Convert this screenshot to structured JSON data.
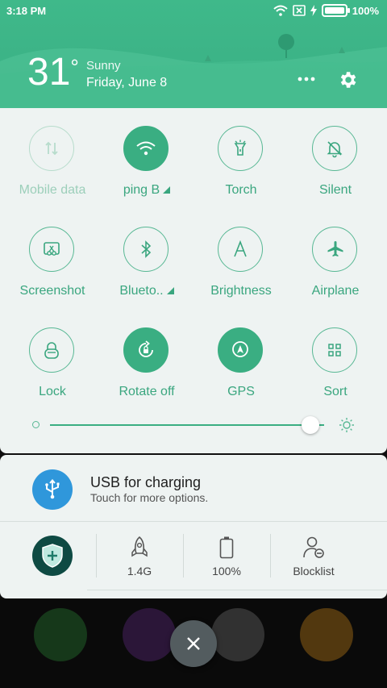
{
  "status": {
    "time": "3:18 PM",
    "battery_level": "100%",
    "battery_fill": 1.0
  },
  "weather": {
    "temperature": "31",
    "degree": "°",
    "condition": "Sunny",
    "date": "Friday, June 8"
  },
  "header_actions": {
    "more_icon": "more-dots-icon",
    "settings_icon": "gear-icon"
  },
  "toggles": [
    {
      "label": "Mobile data",
      "icon": "mobile-data-icon",
      "state": "disabled"
    },
    {
      "label": "ping B",
      "icon": "wifi-icon",
      "state": "on",
      "expandable": true
    },
    {
      "label": "Torch",
      "icon": "torch-icon",
      "state": "off"
    },
    {
      "label": "Silent",
      "icon": "bell-off-icon",
      "state": "off"
    },
    {
      "label": "Screenshot",
      "icon": "scissors-icon",
      "state": "off"
    },
    {
      "label": "Blueto..",
      "icon": "bluetooth-icon",
      "state": "off",
      "expandable": true
    },
    {
      "label": "Brightness",
      "icon": "brightness-a-icon",
      "state": "off"
    },
    {
      "label": "Airplane",
      "icon": "airplane-icon",
      "state": "off"
    },
    {
      "label": "Lock",
      "icon": "lock-icon",
      "state": "off"
    },
    {
      "label": "Rotate off",
      "icon": "rotate-lock-icon",
      "state": "on"
    },
    {
      "label": "GPS",
      "icon": "gps-icon",
      "state": "on"
    },
    {
      "label": "Sort",
      "icon": "grid-icon",
      "state": "off"
    }
  ],
  "brightness": {
    "level": 0.95
  },
  "notification": {
    "title": "USB for charging",
    "subtitle": "Touch for more options.",
    "icon": "usb-icon",
    "icon_color": "#2f97db"
  },
  "quick_stats": [
    {
      "icon": "rocket-icon",
      "label": "1.4G"
    },
    {
      "icon": "battery-icon",
      "label": "100%"
    },
    {
      "icon": "blocklist-icon",
      "label": "Blocklist"
    }
  ],
  "colors": {
    "accent": "#3aae82",
    "header": "#3fb98a",
    "panel": "#eef3f2"
  }
}
